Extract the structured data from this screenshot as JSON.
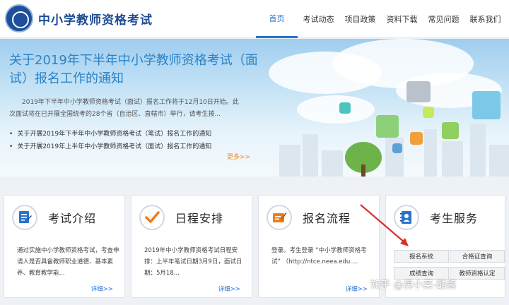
{
  "header": {
    "site_title": "中小学教师资格考试",
    "nav": [
      {
        "label": "首页",
        "active": true
      },
      {
        "label": "考试动态",
        "active": false
      },
      {
        "label": "项目政策",
        "active": false
      },
      {
        "label": "资料下载",
        "active": false
      },
      {
        "label": "常见问题",
        "active": false
      },
      {
        "label": "联系我们",
        "active": false
      }
    ]
  },
  "hero": {
    "title": "关于2019年下半年中小学教师资格考试（面试）报名工作的通知",
    "summary": "2019年下半年中小学教师资格考试（面试）报名工作将于12月10日开始。此次面试将在已开展全国统考的28个省（自治区、直辖市）举行，请考生按...",
    "links": [
      "关于开展2019年下半年中小学教师资格考试（笔试）报名工作的通知",
      "关于开展2019年上半年中小学教师资格考试（面试）报名工作的通知"
    ],
    "more": "更多>>"
  },
  "cards": [
    {
      "title": "考试介绍",
      "icon": "document-icon",
      "desc": "通过实施中小学教师资格考试，考查申请人是否具备教师职业道德、基本素养、教育教学能...",
      "more": "详细>>"
    },
    {
      "title": "日程安排",
      "icon": "checkmark-icon",
      "desc": "2019年中小学教师资格考试日程安排：上半年笔试日期3月9日，面试日期：5月18...",
      "more": "详细>>"
    },
    {
      "title": "报名流程",
      "icon": "edit-icon",
      "desc": "登录。考生登录 “中小学教师资格考试” （http://ntce.neea.edu....",
      "more": "详细>>"
    }
  ],
  "service": {
    "title": "考生服务",
    "icon": "contact-card-icon",
    "buttons": [
      "报名系统",
      "合格证查询",
      "成绩查询",
      "教师资格认定"
    ]
  },
  "watermark": "知乎 @吴小菜-酷酱",
  "colors": {
    "brand_blue": "#1d4c94",
    "nav_active": "#2a73cc",
    "hero_title": "#2b83c8",
    "more_orange": "#f08a24",
    "icon_orange": "#ef7d1a",
    "annotation_red": "#d9302f"
  }
}
